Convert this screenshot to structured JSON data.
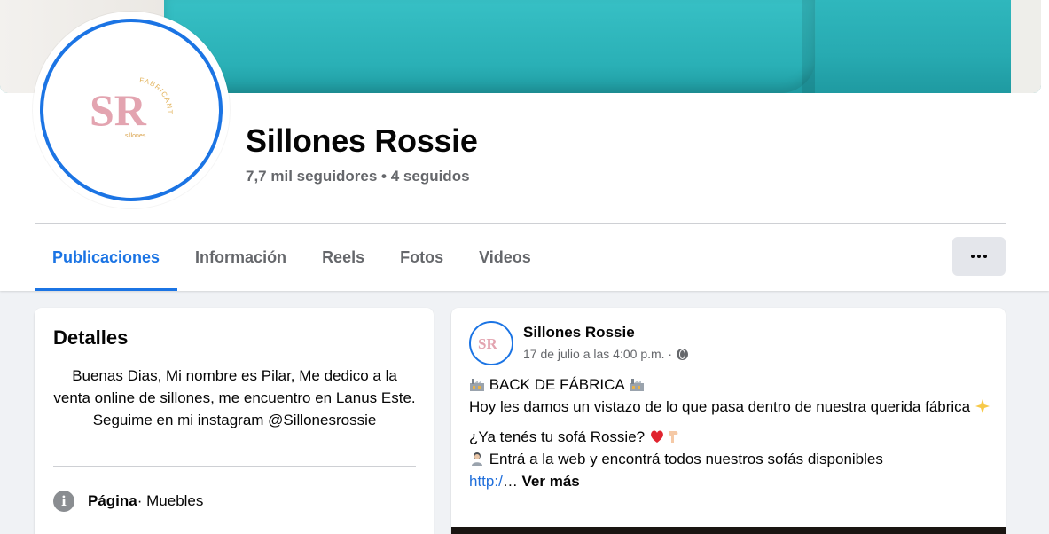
{
  "page": {
    "name": "Sillones Rossie",
    "followers": "7,7 mil seguidores • 4 seguidos"
  },
  "logo": {
    "monogram": "SR",
    "arc_text": "FABRICANTES",
    "sub_text": "sillones",
    "colors": {
      "monogram": "#e3a4b0",
      "arc": "#e2b35c"
    }
  },
  "tabs": [
    {
      "label": "Publicaciones",
      "active": true
    },
    {
      "label": "Información",
      "active": false
    },
    {
      "label": "Reels",
      "active": false
    },
    {
      "label": "Fotos",
      "active": false
    },
    {
      "label": "Videos",
      "active": false
    }
  ],
  "more_button": {
    "icon": "more-dots-icon"
  },
  "details": {
    "title": "Detalles",
    "bio_lines": [
      "Buenas Dias, Mi nombre es Pilar, Me dedico a la venta online de sillones, me encuentro en Lanus Este.",
      "Seguime en mi instagram @Sillonesrossie"
    ],
    "category_label": "Página",
    "category_value": " · Muebles",
    "info_icon": "info-icon"
  },
  "post": {
    "author": "Sillones Rossie",
    "date": "17 de julio a las 4:00 p.m. · ",
    "privacy_icon": "globe-icon",
    "line1": " BACK DE FÁBRICA ",
    "line2": "Hoy les damos un vistazo de lo que pasa dentro de nuestra querida fábrica ",
    "line3": "¿Ya tenés tu sofá Rossie? ",
    "line4": " Entrá a la web y encontrá todos nuestros sofás disponibles",
    "link_text": "http:/",
    "ellipsis": "…",
    "see_more": " Ver más"
  },
  "colors": {
    "accent": "#1b74e4",
    "secondary_text": "#65676b",
    "background": "#f0f2f5",
    "cover_teal": "#2ab0b6"
  }
}
